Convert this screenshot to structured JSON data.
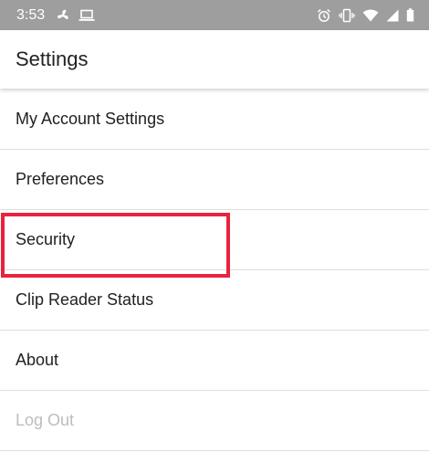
{
  "status_bar": {
    "time": "3:53",
    "icons_left": [
      "fan-icon",
      "laptop-icon"
    ],
    "icons_right": [
      "alarm-icon",
      "vibrate-icon",
      "wifi-icon",
      "signal-icon",
      "battery-icon"
    ]
  },
  "app_bar": {
    "title": "Settings"
  },
  "settings_items": [
    {
      "label": "My Account Settings",
      "enabled": true
    },
    {
      "label": "Preferences",
      "enabled": true
    },
    {
      "label": "Security",
      "enabled": true,
      "highlighted": true
    },
    {
      "label": "Clip Reader Status",
      "enabled": true
    },
    {
      "label": "About",
      "enabled": true
    },
    {
      "label": "Log Out",
      "enabled": false
    }
  ],
  "colors": {
    "status_bar": "#9e9e9e",
    "highlight_border": "#e8233d",
    "disabled_text": "#bdbdbd",
    "divider": "#dedede"
  }
}
